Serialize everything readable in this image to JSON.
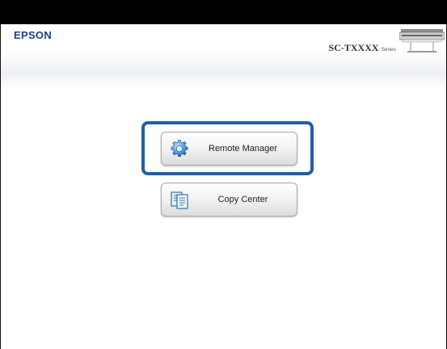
{
  "header": {
    "brand": "EPSON",
    "model": "SC-TXXXX",
    "series": "Series"
  },
  "menu": {
    "items": [
      {
        "label": "Remote Manager",
        "icon": "gear-icon"
      },
      {
        "label": "Copy Center",
        "icon": "document-icon"
      }
    ]
  },
  "colors": {
    "brand": "#1a3f8f",
    "highlight": "#1f5fa8"
  }
}
